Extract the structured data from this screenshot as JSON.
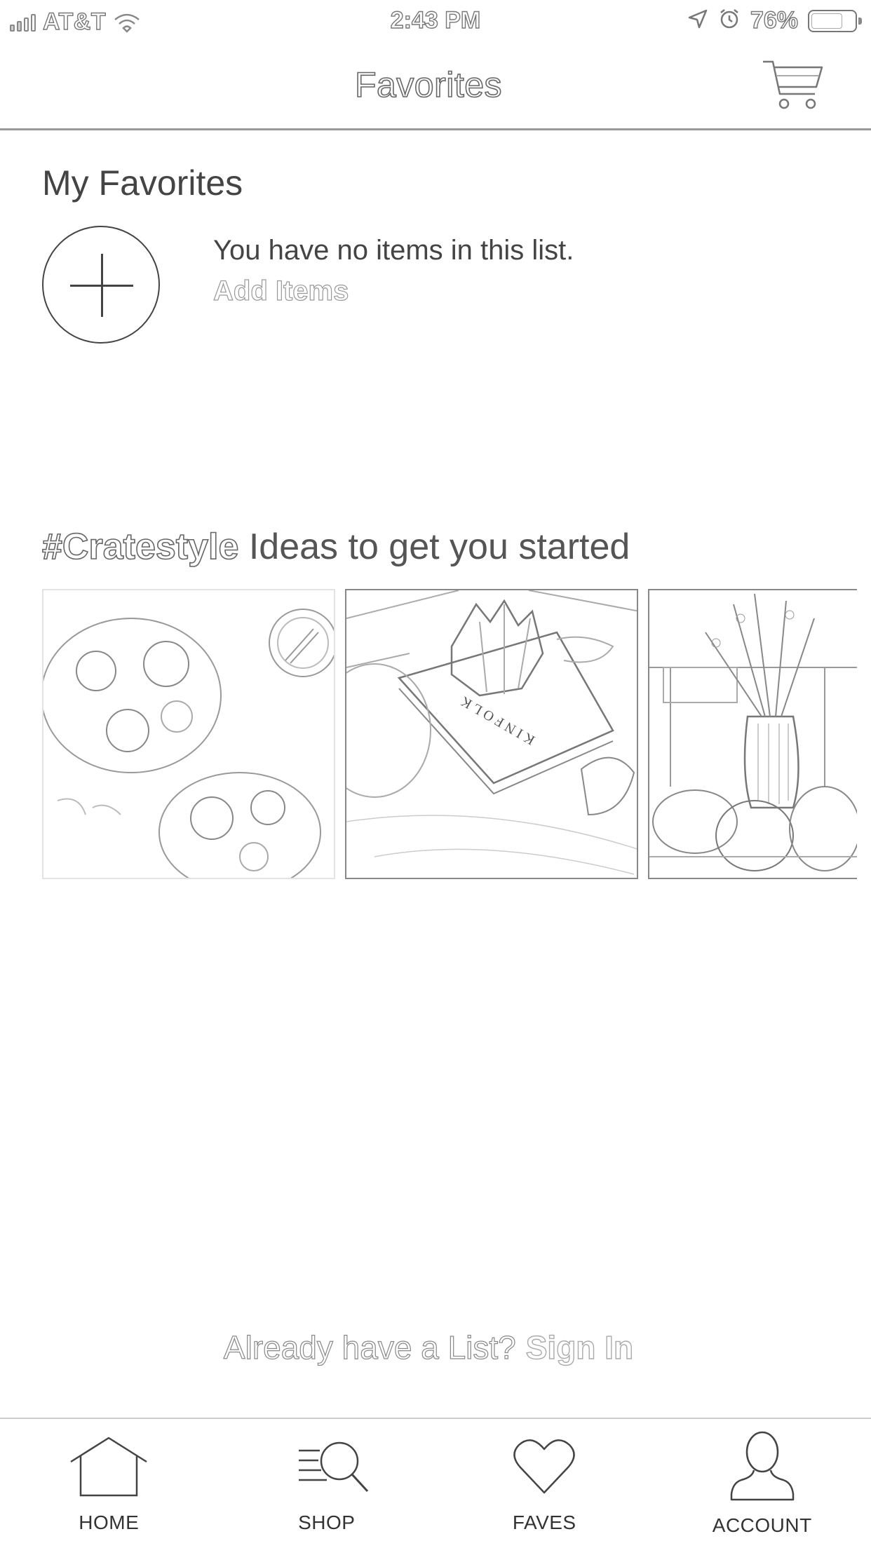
{
  "status_bar": {
    "carrier": "AT&T",
    "time": "2:43 PM",
    "battery": "76%",
    "battery_level": 0.76
  },
  "nav": {
    "title": "Favorites",
    "cart_icon": "cart-icon"
  },
  "favorites": {
    "section_title": "My Favorites",
    "empty_message": "You have no items in this list.",
    "add_items_label": "Add Items",
    "add_icon": "plus-circle-icon"
  },
  "ideas": {
    "hashtag": "#Cratestyle",
    "heading_rest": " Ideas to get you started",
    "tiles": [
      {
        "name": "idea-image-food"
      },
      {
        "name": "idea-image-kinfolk-book",
        "text": "KINFOLK"
      },
      {
        "name": "idea-image-vase"
      }
    ]
  },
  "signin": {
    "question": "Already have a List?",
    "link": "Sign In"
  },
  "tab_bar": {
    "tabs": [
      {
        "label": "HOME",
        "icon": "home-icon"
      },
      {
        "label": "SHOP",
        "icon": "shop-search-icon"
      },
      {
        "label": "FAVES",
        "icon": "heart-icon"
      },
      {
        "label": "ACCOUNT",
        "icon": "account-icon"
      }
    ]
  },
  "colors": {
    "background": "#ffffff",
    "text": "#444444",
    "muted": "#aaaaaa"
  }
}
